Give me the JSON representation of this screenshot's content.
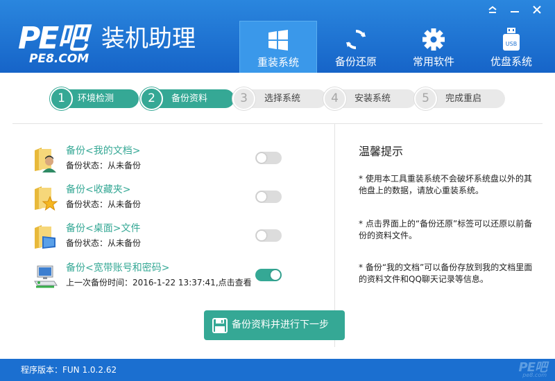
{
  "app": {
    "logo_mark": "PE吧",
    "title": "装机助理",
    "subtitle": "PE8.COM"
  },
  "window_controls": {
    "menu_icon": "menu-icon",
    "minimize_label": "▬",
    "close_label": "✕"
  },
  "nav": {
    "items": [
      {
        "label": "重装系统",
        "icon": "windows-icon"
      },
      {
        "label": "备份还原",
        "icon": "sync-icon"
      },
      {
        "label": "常用软件",
        "icon": "gear-icon"
      },
      {
        "label": "优盘系统",
        "icon": "usb-icon",
        "badge": "USB"
      }
    ],
    "active_index": 0
  },
  "steps": [
    {
      "number": "1",
      "label": "环境检测",
      "state": "done"
    },
    {
      "number": "2",
      "label": "备份资料",
      "state": "done"
    },
    {
      "number": "3",
      "label": "选择系统",
      "state": "todo"
    },
    {
      "number": "4",
      "label": "安装系统",
      "state": "todo"
    },
    {
      "number": "5",
      "label": "完成重启",
      "state": "todo"
    }
  ],
  "backup_items": [
    {
      "title": "备份<我的文档>",
      "status": "备份状态：从未备份",
      "icon": "user-folder-icon",
      "enabled": false
    },
    {
      "title": "备份<收藏夹>",
      "status": "备份状态：从未备份",
      "icon": "favorites-folder-icon",
      "enabled": false
    },
    {
      "title": "备份<桌面>文件",
      "status": "备份状态：从未备份",
      "icon": "desktop-folder-icon",
      "enabled": false
    },
    {
      "title": "备份<宽带账号和密码>",
      "status": "上一次备份时间：2016-1-22 13:37:41,点击查看",
      "icon": "network-computer-icon",
      "enabled": true
    }
  ],
  "tips": {
    "title": "温馨提示",
    "items": [
      "* 使用本工具重装系统不会破坏系统盘以外的其他盘上的数据，请放心重装系统。",
      "* 点击界面上的“备份还原”标签可以还原以前备份的资料文件。",
      "* 备份“我的文档”可以备份存放到我的文档里面的资料文件和QQ聊天记录等信息。"
    ]
  },
  "primary_button": {
    "label": "备份资料并进行下一步",
    "icon": "save-icon"
  },
  "footer": {
    "version": "程序版本：FUN 1.0.2.62",
    "logo": "PE吧",
    "logo_sub": "pe8.com"
  },
  "colors": {
    "header": "#1e72d2",
    "accent": "#35a895",
    "inactive": "#e9e9e9",
    "footer": "#1b6fd0"
  }
}
